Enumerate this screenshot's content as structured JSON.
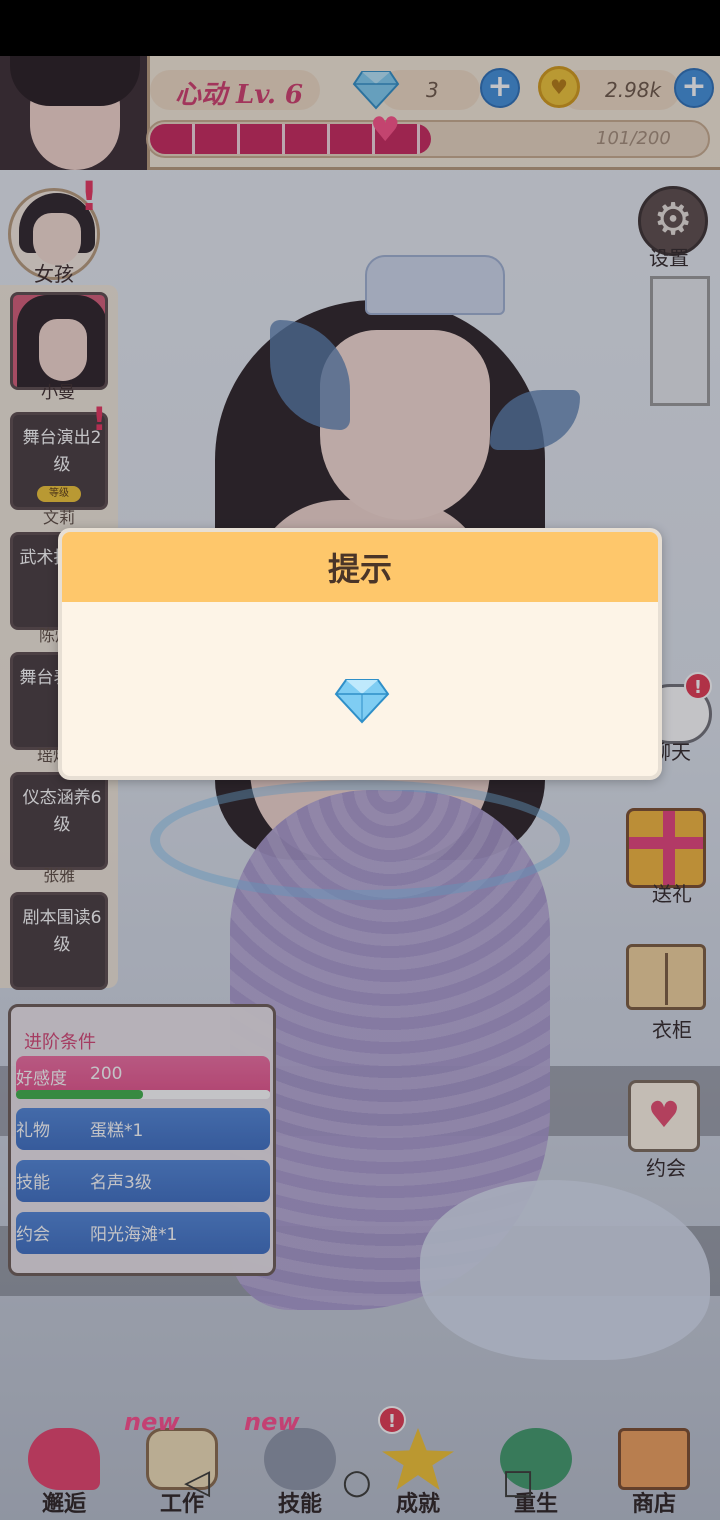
{
  "header": {
    "level_label": "心动 Lv. 6",
    "diamonds": "3",
    "coins": "2.98k",
    "coin_symbol": "♥",
    "plus": "+",
    "favor_text": "101/200",
    "favor_progress": 0.505
  },
  "left_column": {
    "girl_label": "女孩",
    "alert": "!",
    "portrait_label": "小曼",
    "tasks": [
      {
        "title": "舞台演出2级",
        "sub": "文莉",
        "tag": "等级"
      },
      {
        "title": "武术指导级",
        "sub": "陈灿"
      },
      {
        "title": "舞台表演级",
        "sub": "瑶灿"
      },
      {
        "title": "仪态涵养6级",
        "sub": "张雅"
      },
      {
        "title": "剧本围读6级",
        "sub": ""
      }
    ]
  },
  "right_column": {
    "settings_label": "设置",
    "chat_label": "聊天",
    "chat_badge": "!",
    "gift_label": "送礼",
    "wardrobe_label": "衣柜",
    "date_label": "约会",
    "date_icon": "♥",
    "gear_icon": "⚙"
  },
  "conditions": {
    "title": "进阶条件",
    "rows": [
      {
        "key": "好感度",
        "value": "200"
      },
      {
        "key": "礼物",
        "value": "蛋糕*1"
      },
      {
        "key": "技能",
        "value": "名声3级"
      },
      {
        "key": "约会",
        "value": "阳光海滩*1"
      }
    ],
    "favor_progress": 0.5
  },
  "bottom_nav": {
    "items": [
      {
        "label": "邂逅"
      },
      {
        "label": "工作"
      },
      {
        "label": "技能"
      },
      {
        "label": "成就"
      },
      {
        "label": "重生"
      },
      {
        "label": "商店"
      }
    ],
    "new_badge": "new",
    "alert": "!"
  },
  "system_nav": {
    "back": "◁",
    "home": "○",
    "recent": "□"
  },
  "dialog": {
    "title": "提示",
    "icon": "diamond-icon"
  },
  "colors": {
    "dialog_header": "#fec76b",
    "favor_bar": "#c9245a",
    "accent_pink": "#e64f89",
    "accent_blue": "#3d6fc4"
  }
}
